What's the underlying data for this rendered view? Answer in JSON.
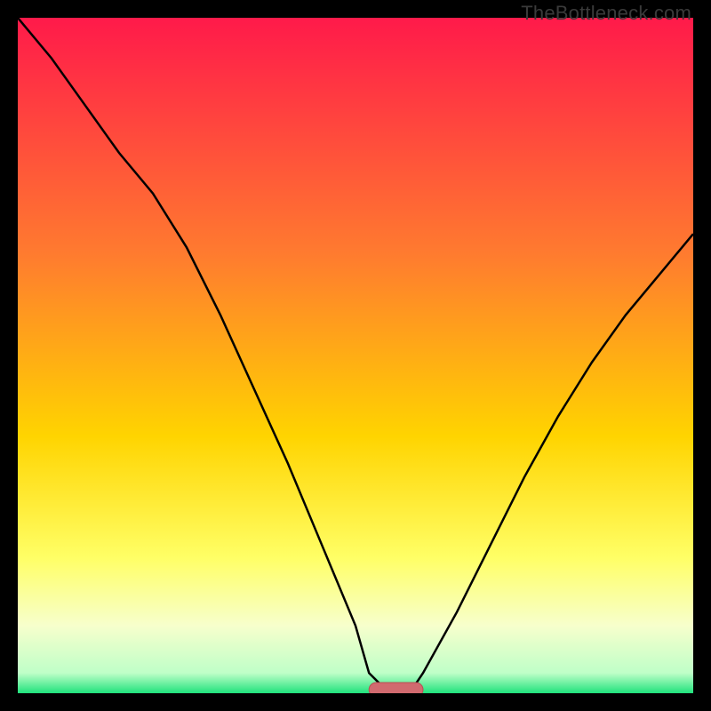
{
  "watermark": "TheBottleneck.com",
  "colors": {
    "bg_top": "#ff1a4a",
    "bg_mid1": "#ff7b2f",
    "bg_mid2": "#ffd400",
    "bg_low1": "#ffff66",
    "bg_low2": "#f7ffcc",
    "bg_green": "#1fe27c",
    "curve": "#000000",
    "marker_fill": "#d16a6f",
    "marker_stroke": "#b94e53",
    "frame": "#000000"
  },
  "chart_data": {
    "type": "line",
    "title": "",
    "xlabel": "",
    "ylabel": "",
    "xlim": [
      0,
      100
    ],
    "ylim": [
      0,
      100
    ],
    "x": [
      0,
      5,
      10,
      15,
      20,
      25,
      30,
      35,
      40,
      45,
      50,
      52,
      55,
      58,
      60,
      65,
      70,
      75,
      80,
      85,
      90,
      95,
      100
    ],
    "values": [
      100,
      94,
      87,
      80,
      74,
      66,
      56,
      45,
      34,
      22,
      10,
      3,
      0,
      0,
      3,
      12,
      22,
      32,
      41,
      49,
      56,
      62,
      68
    ],
    "optimum_x": 56,
    "marker": {
      "x_start": 52,
      "x_end": 60,
      "y": 0
    },
    "gradient_stops": [
      {
        "pct": 0,
        "color": "#ff1a4a"
      },
      {
        "pct": 35,
        "color": "#ff7b2f"
      },
      {
        "pct": 62,
        "color": "#ffd400"
      },
      {
        "pct": 80,
        "color": "#ffff66"
      },
      {
        "pct": 90,
        "color": "#f7ffcc"
      },
      {
        "pct": 97,
        "color": "#bfffc8"
      },
      {
        "pct": 100,
        "color": "#1fe27c"
      }
    ]
  }
}
